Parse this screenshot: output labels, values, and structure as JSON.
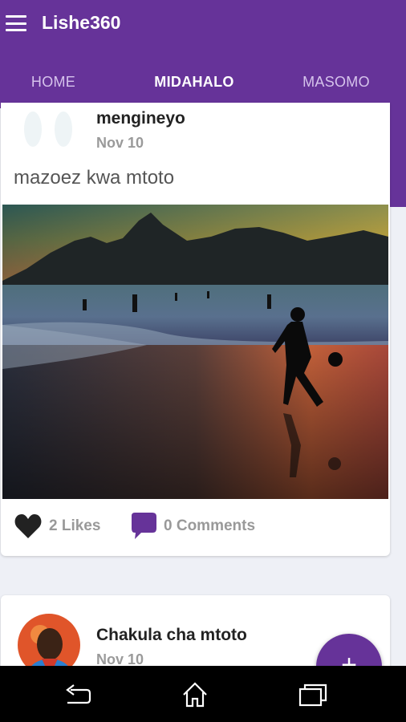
{
  "app": {
    "title": "Lishe360",
    "colors": {
      "primary": "#663399",
      "background": "#eef0f6"
    },
    "menu_icon": "hamburger-icon"
  },
  "tabs": [
    {
      "label": "HOME",
      "active": false
    },
    {
      "label": "MIDAHALO",
      "active": true
    },
    {
      "label": "MASOMO",
      "active": false
    }
  ],
  "posts": [
    {
      "author": "mengineyo",
      "date": "Nov 10",
      "text": "mazoez kwa mtoto",
      "image": "beach-sunset-boy-football",
      "likes_label": "2 Likes",
      "comments_label": "0 Comments",
      "like_icon": "heart-icon",
      "comment_icon": "comment-bubble-icon"
    },
    {
      "author": "Chakula cha mtoto",
      "date": "Nov 10",
      "avatar": "profile-photo"
    }
  ],
  "fab": {
    "label": "+",
    "icon": "plus-icon"
  },
  "system_nav": [
    "back-icon",
    "home-icon",
    "recent-apps-icon"
  ]
}
